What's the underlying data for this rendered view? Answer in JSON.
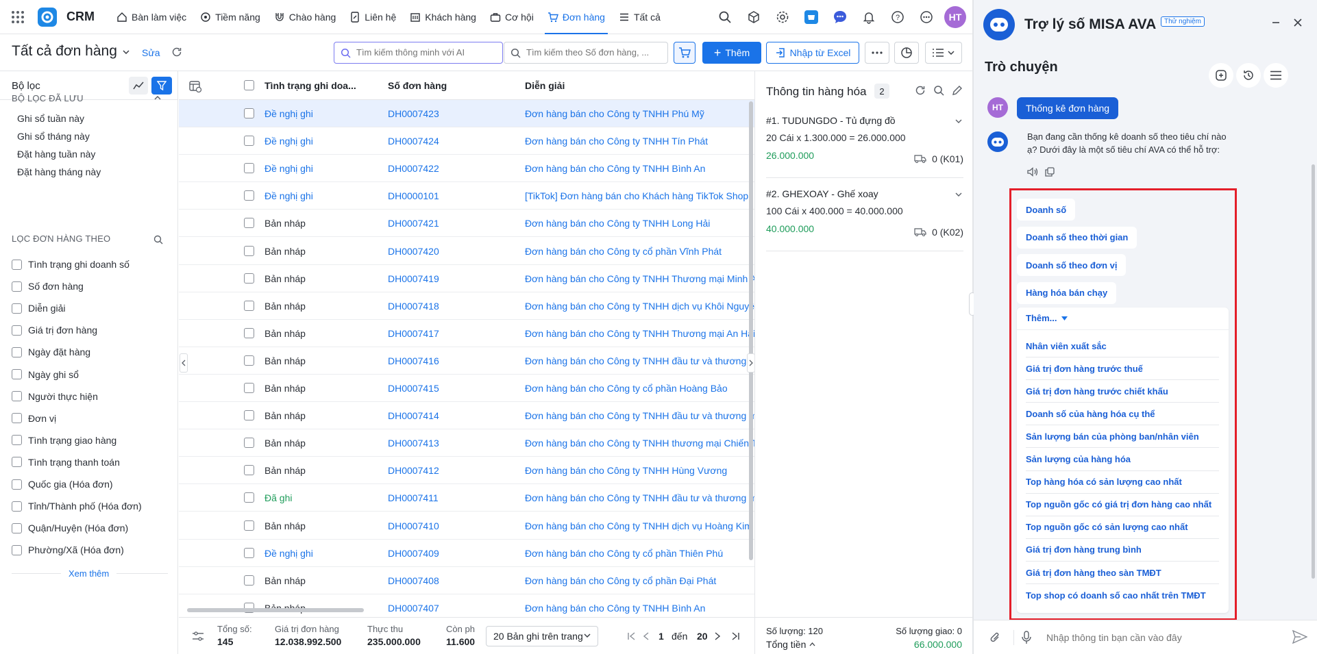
{
  "topbar": {
    "brand": "CRM",
    "nav": [
      {
        "label": "Bàn làm việc",
        "icon": "home-icon"
      },
      {
        "label": "Tiềm năng",
        "icon": "target-icon"
      },
      {
        "label": "Chào hàng",
        "icon": "magnet-icon"
      },
      {
        "label": "Liên hệ",
        "icon": "contact-icon"
      },
      {
        "label": "Khách hàng",
        "icon": "building-icon"
      },
      {
        "label": "Cơ hội",
        "icon": "briefcase-icon"
      },
      {
        "label": "Đơn hàng",
        "icon": "cart-icon",
        "active": true
      },
      {
        "label": "Tất cả",
        "icon": "menu-icon"
      }
    ],
    "avatar": "HT"
  },
  "subbar": {
    "title": "Tất cả đơn hàng",
    "edit": "Sửa",
    "ai_search_placeholder": "Tìm kiếm thông minh với AI",
    "search_placeholder": "Tìm kiếm theo Số đơn hàng, ...",
    "add": "Thêm",
    "import": "Nhập từ Excel"
  },
  "filter": {
    "title": "Bộ lọc",
    "saved_title": "BỘ LỌC ĐÃ LƯU",
    "saved": [
      "Ghi sổ tuần này",
      "Ghi sổ tháng này",
      "Đặt hàng tuần này",
      "Đặt hàng tháng này"
    ],
    "by_title": "LỌC ĐƠN HÀNG THEO",
    "fields": [
      "Tình trạng ghi doanh số",
      "Số đơn hàng",
      "Diễn giải",
      "Giá trị đơn hàng",
      "Ngày đặt hàng",
      "Ngày ghi sổ",
      "Người thực hiện",
      "Đơn vị",
      "Tình trạng giao hàng",
      "Tình trạng thanh toán",
      "Quốc gia (Hóa đơn)",
      "Tỉnh/Thành phố (Hóa đơn)",
      "Quận/Huyện (Hóa đơn)",
      "Phường/Xã (Hóa đơn)"
    ],
    "see_more": "Xem thêm"
  },
  "table": {
    "headers": [
      "Tình trạng ghi doa...",
      "Số đơn hàng",
      "Diễn giải"
    ],
    "rows": [
      {
        "status": "Đề nghị ghi",
        "kind": "blue",
        "id": "DH0007423",
        "desc": "Đơn hàng bán cho Công ty TNHH Phú Mỹ"
      },
      {
        "status": "Đề nghị ghi",
        "kind": "blue",
        "id": "DH0007424",
        "desc": "Đơn hàng bán cho Công ty TNHH Tín Phát"
      },
      {
        "status": "Đề nghị ghi",
        "kind": "blue",
        "id": "DH0007422",
        "desc": "Đơn hàng bán cho Công ty TNHH Bình An"
      },
      {
        "status": "Đề nghị ghi",
        "kind": "blue",
        "id": "DH0000101",
        "desc": "[TikTok] Đơn hàng bán cho Khách hàng TikTok Shop"
      },
      {
        "status": "Bản nháp",
        "kind": "gray",
        "id": "DH0007421",
        "desc": "Đơn hàng bán cho Công ty TNHH Long Hải"
      },
      {
        "status": "Bản nháp",
        "kind": "gray",
        "id": "DH0007420",
        "desc": "Đơn hàng bán cho Công ty cổ phần Vĩnh Phát"
      },
      {
        "status": "Bản nháp",
        "kind": "gray",
        "id": "DH0007419",
        "desc": "Đơn hàng bán cho Công ty TNHH Thương mại Minh A"
      },
      {
        "status": "Bản nháp",
        "kind": "gray",
        "id": "DH0007418",
        "desc": "Đơn hàng bán cho Công ty TNHH dịch vụ Khôi Nguyê"
      },
      {
        "status": "Bản nháp",
        "kind": "gray",
        "id": "DH0007417",
        "desc": "Đơn hàng bán cho Công ty TNHH Thương mại An Hải"
      },
      {
        "status": "Bản nháp",
        "kind": "gray",
        "id": "DH0007416",
        "desc": "Đơn hàng bán cho Công ty TNHH đầu tư và thương m"
      },
      {
        "status": "Bản nháp",
        "kind": "gray",
        "id": "DH0007415",
        "desc": "Đơn hàng bán cho Công ty cổ phần Hoàng Bảo"
      },
      {
        "status": "Bản nháp",
        "kind": "gray",
        "id": "DH0007414",
        "desc": "Đơn hàng bán cho Công ty TNHH đầu tư và thương m"
      },
      {
        "status": "Bản nháp",
        "kind": "gray",
        "id": "DH0007413",
        "desc": "Đơn hàng bán cho Công ty TNHH thương mại Chiến T"
      },
      {
        "status": "Bản nháp",
        "kind": "gray",
        "id": "DH0007412",
        "desc": "Đơn hàng bán cho Công ty TNHH Hùng Vương"
      },
      {
        "status": "Đã ghi",
        "kind": "green",
        "id": "DH0007411",
        "desc": "Đơn hàng bán cho Công ty TNHH đầu tư và thương m"
      },
      {
        "status": "Bản nháp",
        "kind": "gray",
        "id": "DH0007410",
        "desc": "Đơn hàng bán cho Công ty TNHH dịch vụ Hoàng Kim"
      },
      {
        "status": "Đề nghị ghi",
        "kind": "blue",
        "id": "DH0007409",
        "desc": "Đơn hàng bán cho Công ty cổ phần Thiên Phú"
      },
      {
        "status": "Bản nháp",
        "kind": "gray",
        "id": "DH0007408",
        "desc": "Đơn hàng bán cho Công ty cổ phần Đại Phát"
      },
      {
        "status": "Bản nháp",
        "kind": "gray",
        "id": "DH0007407",
        "desc": "Đơn hàng bán cho Công ty TNHH Bình An"
      }
    ]
  },
  "footer": {
    "total_label": "Tổng số:",
    "total": "145",
    "value_label": "Giá trị đơn hàng",
    "value": "12.038.992.500",
    "received_label": "Thực thu",
    "received": "235.000.000",
    "remain_label": "Còn ph",
    "remain": "11.600",
    "page_size": "20 Bản ghi trên trang",
    "page_from": "1",
    "page_to_label": "đến",
    "page_to": "20"
  },
  "detail": {
    "title": "Thông tin hàng hóa",
    "count": "2",
    "items": [
      {
        "name": "#1. TUDUNGDO - Tủ đựng đồ",
        "calc": "20 Cái x 1.300.000 = 26.000.000",
        "amount": "26.000.000",
        "qty": "0 (K01)"
      },
      {
        "name": "#2. GHEXOAY - Ghế xoay",
        "calc": "100 Cái x 400.000 = 40.000.000",
        "amount": "40.000.000",
        "qty": "0 (K02)"
      }
    ],
    "qty_label": "Số lượng: 120",
    "delivered_label": "Số lượng giao: 0",
    "total_label": "Tổng tiền",
    "total_value": "66.000.000"
  },
  "chat": {
    "title": "Trợ lý số MISA AVA",
    "beta": "Thử nghiệm",
    "subtitle": "Trò chuyện",
    "user_avatar": "HT",
    "user_message": "Thống kê đơn hàng",
    "bot_message": "Bạn đang cần thống kê doanh số theo tiêu chí nào ạ? Dưới đây là một số tiêu chí AVA có thể hỗ trợ:",
    "chips": [
      "Doanh số",
      "Doanh số theo thời gian",
      "Doanh số theo đơn vị",
      "Hàng hóa bán chạy"
    ],
    "more_label": "Thêm...",
    "options": [
      "Nhân viên xuất sắc",
      "Giá trị đơn hàng trước thuế",
      "Giá trị đơn hàng trước chiết khấu",
      "Doanh số của hàng hóa cụ thể",
      "Sản lượng bán của phòng ban/nhân viên",
      "Sản lượng của hàng hóa",
      "Top hàng hóa có sản lượng cao nhất",
      "Top nguồn gốc có giá trị đơn hàng cao nhất",
      "Top nguồn gốc có sản lượng cao nhất",
      "Giá trị đơn hàng trung bình",
      "Giá trị đơn hàng theo sàn TMĐT",
      "Top shop có doanh số cao nhất trên TMĐT"
    ],
    "input_placeholder": "Nhập thông tin bạn cần vào đây"
  },
  "colors": {
    "accent": "#1a73e8",
    "highlight_border": "#e41e2a",
    "positive": "#1e9c5a"
  }
}
